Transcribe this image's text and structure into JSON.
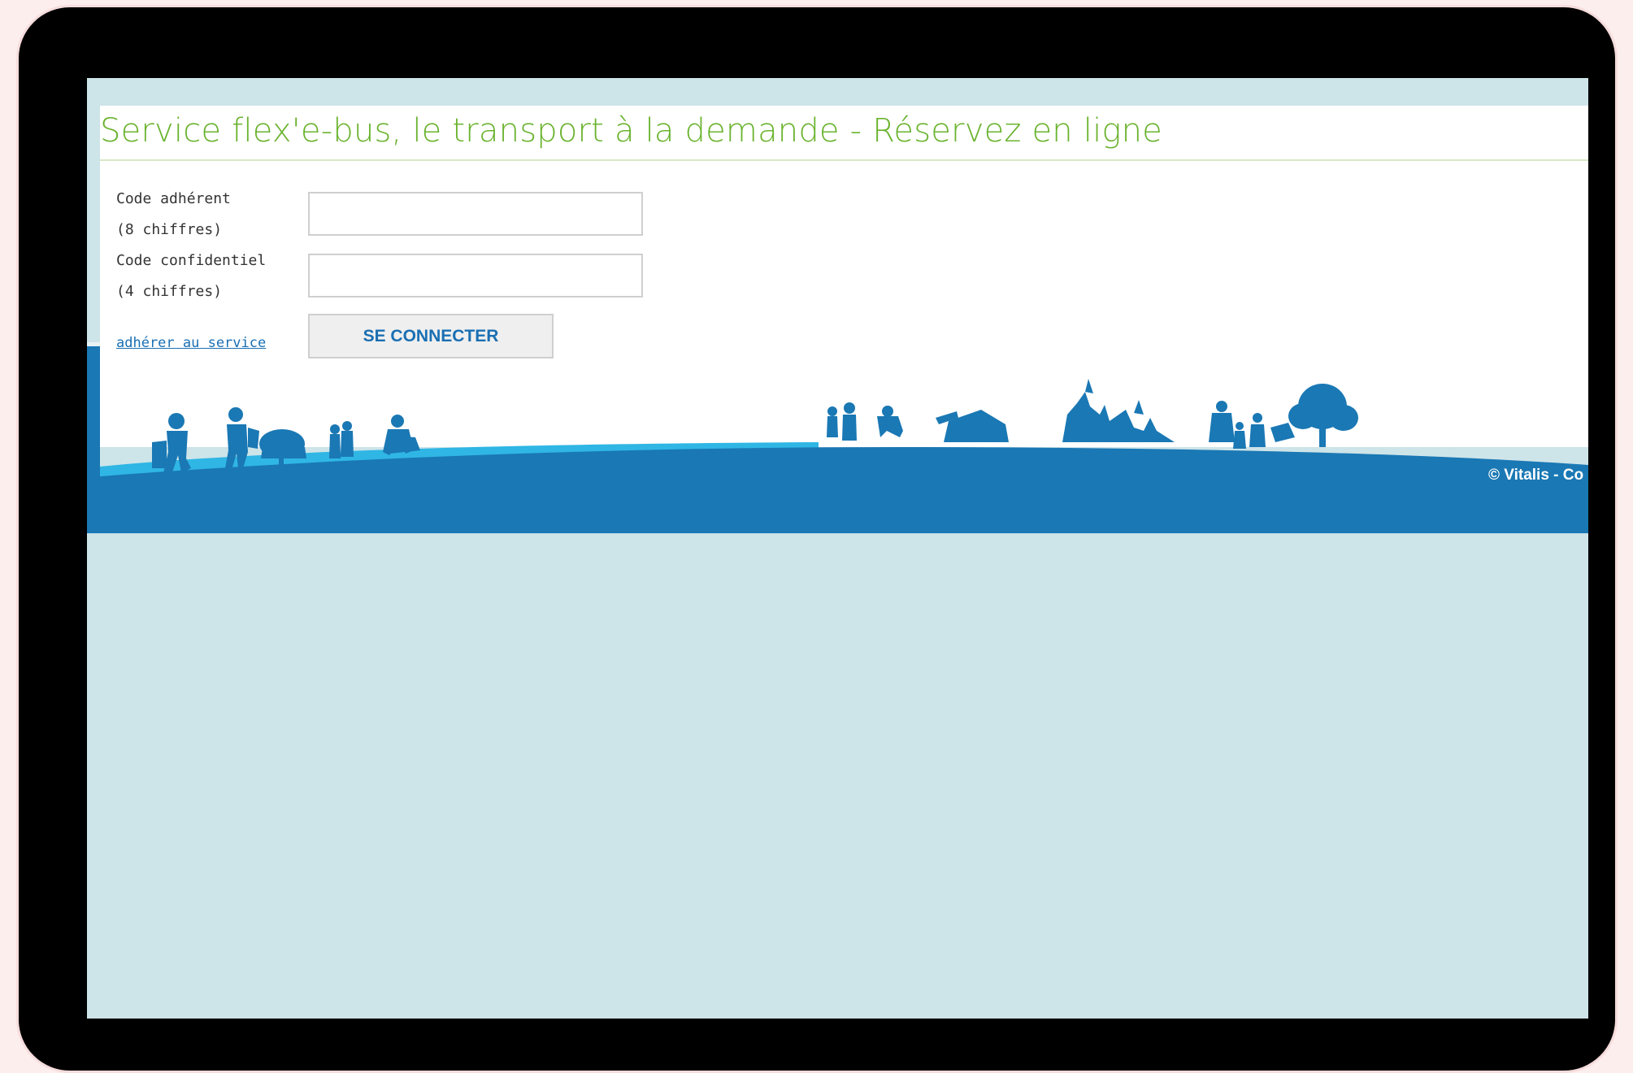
{
  "page": {
    "title": "Service flex'e-bus, le transport à la demande - Réservez en ligne"
  },
  "login_form": {
    "member_code": {
      "label": "Code adhérent",
      "hint": "(8 chiffres)",
      "value": ""
    },
    "pin_code": {
      "label": "Code confidentiel",
      "hint": "(4 chiffres)",
      "value": ""
    },
    "join_link": "adhérer au service",
    "submit_label": "SE CONNECTER"
  },
  "footer": {
    "copyright": "© Vitalis - Co"
  },
  "colors": {
    "title_green": "#6ab32e",
    "brand_blue": "#1a78b4",
    "light_blue": "#2fb6e4",
    "page_bg": "#cde4e9",
    "link_blue": "#1a6fb3"
  }
}
